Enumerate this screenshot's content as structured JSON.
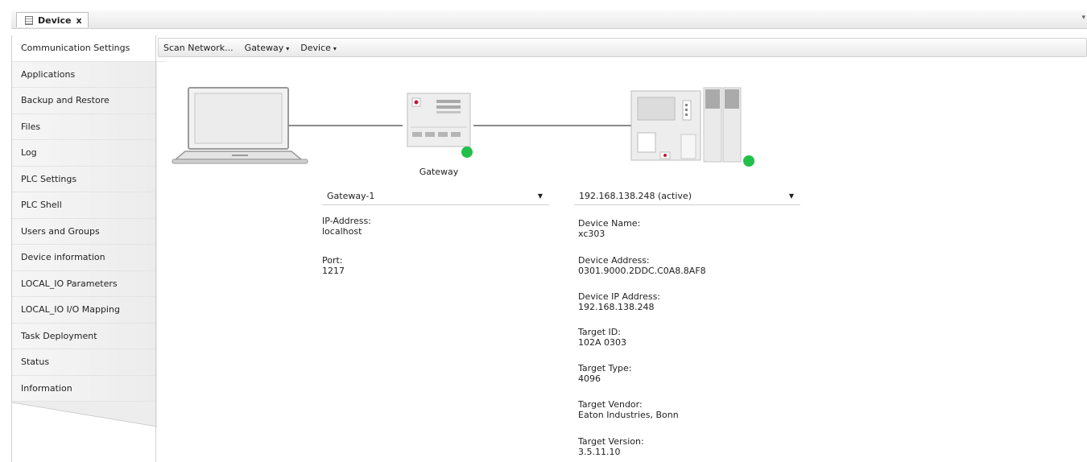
{
  "tab": {
    "title": "Device",
    "close": "x"
  },
  "sidebar": {
    "items": [
      {
        "label": "Communication Settings"
      },
      {
        "label": "Applications"
      },
      {
        "label": "Backup and Restore"
      },
      {
        "label": "Files"
      },
      {
        "label": "Log"
      },
      {
        "label": "PLC Settings"
      },
      {
        "label": "PLC Shell"
      },
      {
        "label": "Users and Groups"
      },
      {
        "label": "Device information"
      },
      {
        "label": "LOCAL_IO Parameters"
      },
      {
        "label": "LOCAL_IO I/O Mapping"
      },
      {
        "label": "Task Deployment"
      },
      {
        "label": "Status"
      },
      {
        "label": "Information"
      }
    ]
  },
  "toolbar": {
    "scan": "Scan Network...",
    "gateway": "Gateway",
    "device": "Device"
  },
  "diagram": {
    "gateway_caption": "Gateway",
    "status_color": "#22c04a"
  },
  "gateway": {
    "selected": "Gateway-1",
    "ip_label": "IP-Address:",
    "ip_value": "localhost",
    "port_label": "Port:",
    "port_value": "1217"
  },
  "device": {
    "selected": "192.168.138.248 (active)",
    "fields": [
      {
        "label": "Device Name:",
        "value": "xc303"
      },
      {
        "label": "Device Address:",
        "value": "0301.9000.2DDC.C0A8.8AF8"
      },
      {
        "label": "Device IP Address:",
        "value": "192.168.138.248"
      },
      {
        "label": "Target ID:",
        "value": "102A 0303"
      },
      {
        "label": "Target Type:",
        "value": "4096"
      },
      {
        "label": "Target Vendor:",
        "value": "Eaton Industries, Bonn"
      },
      {
        "label": "Target Version:",
        "value": "3.5.11.10"
      }
    ]
  }
}
